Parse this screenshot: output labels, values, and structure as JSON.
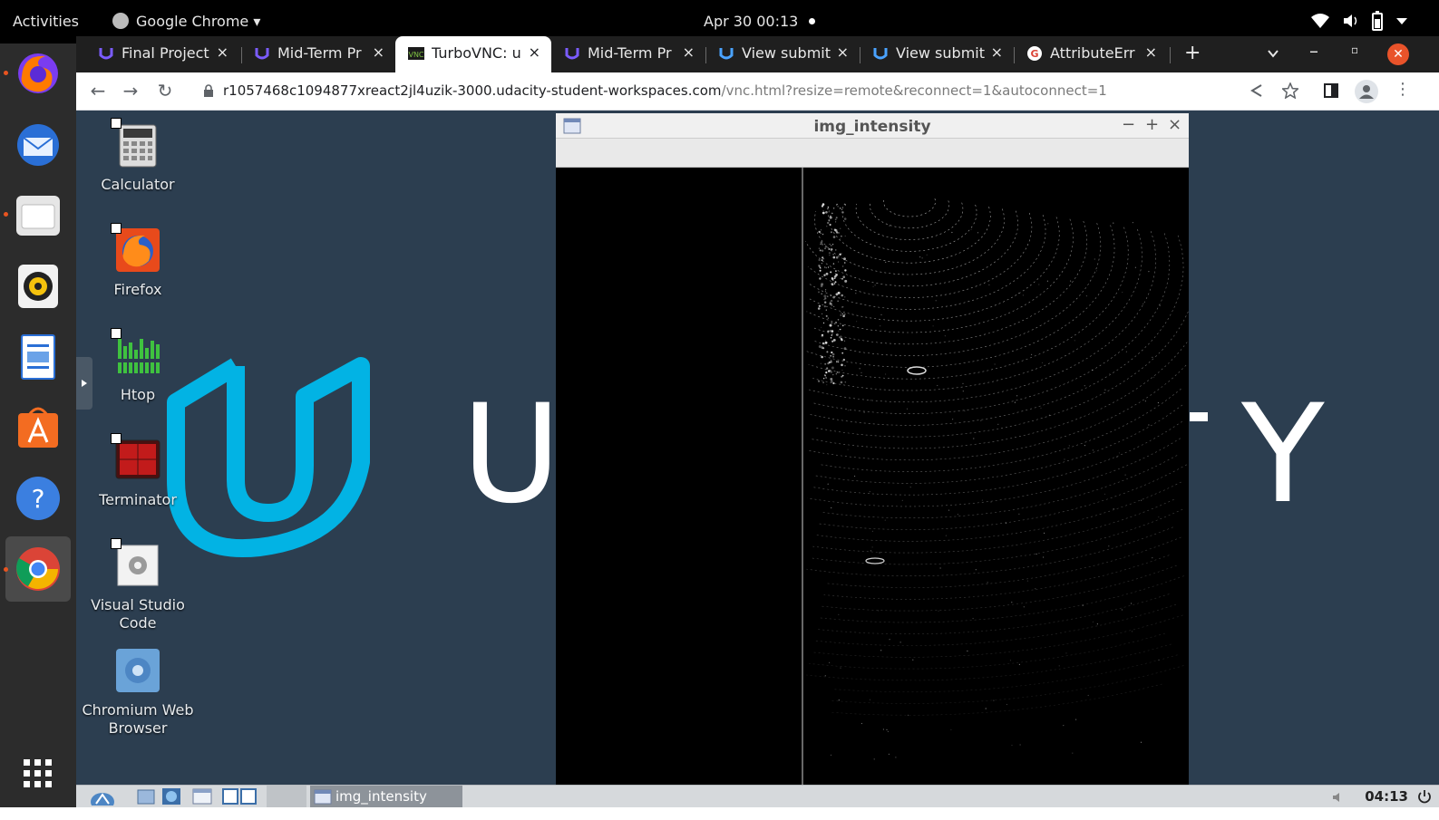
{
  "gnome_topbar": {
    "activities": "Activities",
    "app_menu": "Google Chrome ▾",
    "datetime": "Apr 30  00:13",
    "status_icons": [
      "wifi-icon",
      "volume-icon",
      "battery-icon",
      "chevron-down-icon"
    ]
  },
  "chrome": {
    "tabs": [
      {
        "title": "Final Project",
        "icon": "udacity-icon",
        "active": false
      },
      {
        "title": "Mid-Term Pr",
        "icon": "udacity-icon",
        "active": false
      },
      {
        "title": "TurboVNC: u",
        "icon": "vnc-icon",
        "active": true
      },
      {
        "title": "Mid-Term Pr",
        "icon": "udacity-icon",
        "active": false
      },
      {
        "title": "View submit",
        "icon": "udacity-icon",
        "active": false
      },
      {
        "title": "View submit",
        "icon": "udacity-icon",
        "active": false
      },
      {
        "title": "AttributeErr",
        "icon": "google-icon",
        "active": false
      }
    ],
    "new_tab": "+",
    "url_host": "r1057468c1094877xreact2jl4uzik-3000.udacity-student-workspaces.com",
    "url_path": "/vnc.html?resize=remote&reconnect=1&autoconnect=1"
  },
  "dock": {
    "apps": [
      "firefox-icon",
      "thunderbird-icon",
      "files-icon",
      "rhythmbox-icon",
      "writer-icon",
      "software-icon",
      "help-icon",
      "chrome-icon",
      "app-grid-icon"
    ]
  },
  "desktop": {
    "icons": [
      {
        "label": "Calculator",
        "icon": "calculator-icon"
      },
      {
        "label": "Firefox",
        "icon": "firefox-icon"
      },
      {
        "label": "Htop",
        "icon": "htop-icon"
      },
      {
        "label": "Terminator",
        "icon": "terminator-icon"
      },
      {
        "label": "Visual Studio Code",
        "icon": "vscode-icon"
      },
      {
        "label": "Chromium Web Browser",
        "icon": "chromium-icon"
      }
    ],
    "wallpaper_letters": {
      "u": "U",
      "y": "Y"
    },
    "accent": "#02b3e4",
    "background": "#2c3e50"
  },
  "image_window": {
    "title": "img_intensity",
    "buttons": {
      "minimize": "−",
      "maximize": "+",
      "close": "×"
    }
  },
  "panel": {
    "task_label": "img_intensity",
    "clock": "04:13"
  }
}
